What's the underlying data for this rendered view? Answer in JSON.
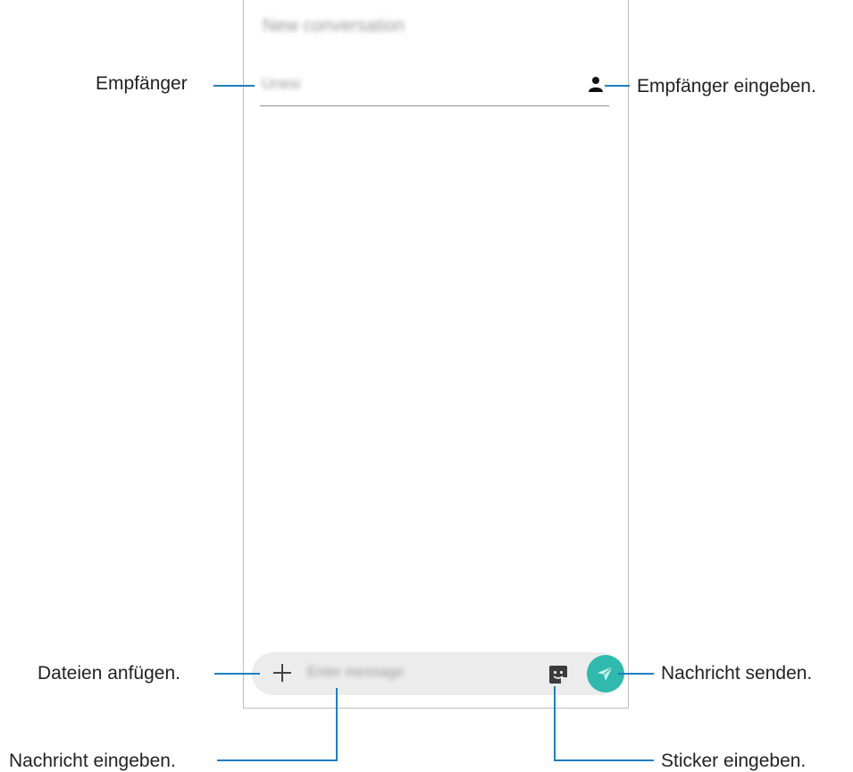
{
  "screen": {
    "title": "New conversation",
    "recipient_placeholder": "Unesi",
    "message_placeholder": "Enter message"
  },
  "callouts": {
    "recipient": "Empfänger",
    "enter_recipient": "Empfänger eingeben.",
    "attach_files": "Dateien anfügen.",
    "send_message": "Nachricht senden.",
    "enter_message": "Nachricht eingeben.",
    "enter_sticker": "Sticker eingeben."
  },
  "colors": {
    "accent": "#2fbaad",
    "callout_line": "#1f7fc1"
  },
  "icons": [
    "contact-icon",
    "plus-icon",
    "sticker-icon",
    "send-icon"
  ]
}
